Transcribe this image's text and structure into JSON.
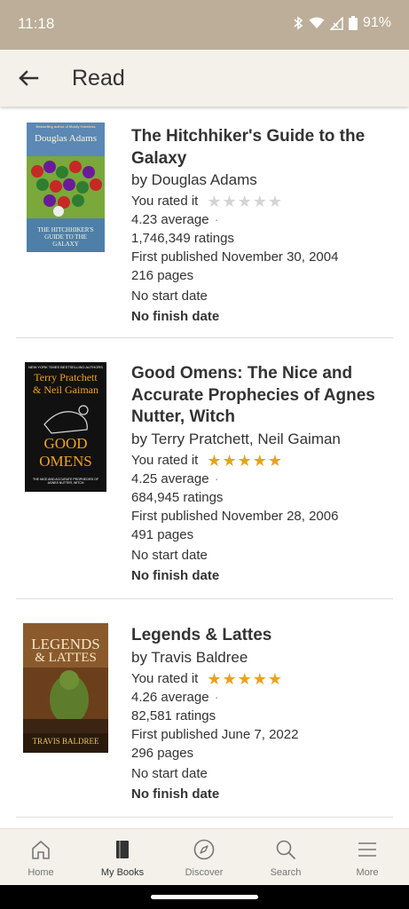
{
  "status_bar": {
    "time": "11:18",
    "battery": "91%"
  },
  "app_bar": {
    "title": "Read",
    "back_icon": "arrow-left-icon"
  },
  "books": [
    {
      "title": "The Hitchhiker's Guide to the Galaxy",
      "author": "by Douglas Adams",
      "rated_label": "You rated it",
      "user_rating": 0,
      "max_rating": 5,
      "average": "4.23 average",
      "ratings": "1,746,349 ratings",
      "first_published": "First published November 30, 2004",
      "pages": "216 pages",
      "start_date": "No start date",
      "finish_date": "No finish date",
      "cover": {
        "tagline": "Bestselling author of Mostly Harmless",
        "author": "Douglas Adams",
        "title": "THE HITCHHIKER'S GUIDE TO THE GALAXY",
        "bg": "#5b88b4"
      }
    },
    {
      "title": "Good Omens: The Nice and Accurate Prophecies of Agnes Nutter, Witch",
      "author": "by Terry Pratchett, Neil Gaiman",
      "rated_label": "You rated it",
      "user_rating": 5,
      "max_rating": 5,
      "average": "4.25 average",
      "ratings": "684,945 ratings",
      "first_published": "First published November 28, 2006",
      "pages": "491 pages",
      "start_date": "No start date",
      "finish_date": "No finish date",
      "cover": {
        "tagline": "NEW YORK TIMES BESTSELLING AUTHORS",
        "author_1": "Terry Pratchett",
        "author_2": "& Neil Gaiman",
        "title": "GOOD OMENS",
        "subtitle": "THE NICE AND ACCURATE PROPHECIES OF AGNES NUTTER, WITCH",
        "bg": "#111111"
      }
    },
    {
      "title": "Legends & Lattes",
      "author": "by Travis Baldree",
      "rated_label": "You rated it",
      "user_rating": 5,
      "max_rating": 5,
      "average": "4.26 average",
      "ratings": "82,581 ratings",
      "first_published": "First published June 7, 2022",
      "pages": "296 pages",
      "start_date": "No start date",
      "finish_date": "No finish date",
      "cover": {
        "title_1": "LEGENDS",
        "title_2": "& LATTES",
        "author": "TRAVIS BALDREE",
        "bg": "#7a4a22"
      }
    }
  ],
  "bottom_nav": [
    {
      "label": "Home",
      "icon": "home-icon",
      "active": false
    },
    {
      "label": "My Books",
      "icon": "book-icon",
      "active": true
    },
    {
      "label": "Discover",
      "icon": "compass-icon",
      "active": false
    },
    {
      "label": "Search",
      "icon": "search-icon",
      "active": false
    },
    {
      "label": "More",
      "icon": "menu-icon",
      "active": false
    }
  ],
  "colors": {
    "status_bar": "#bcae98",
    "app_bar": "#f4f1ea",
    "star_on": "#e9a31a",
    "star_off": "#d4d4d4"
  }
}
